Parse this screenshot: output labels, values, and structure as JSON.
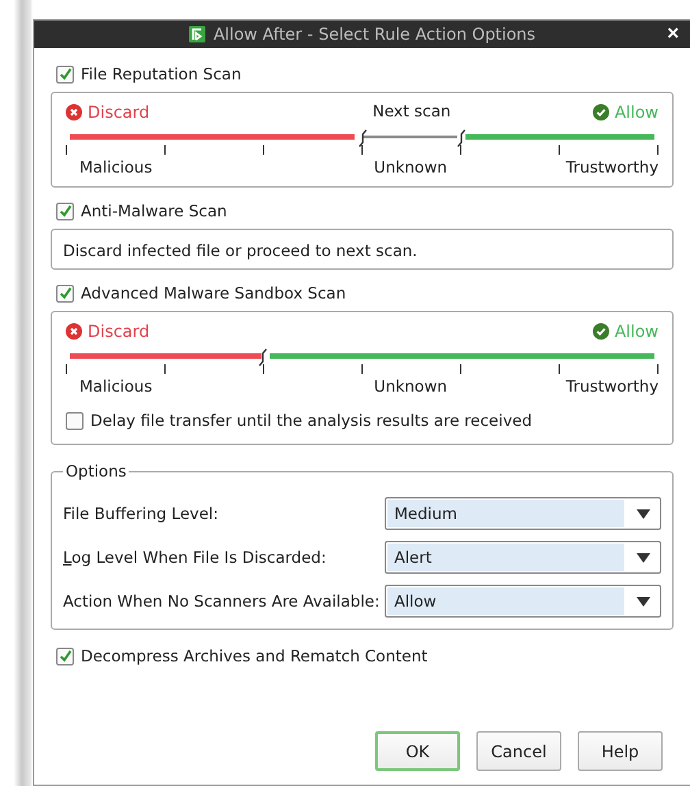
{
  "window": {
    "title": "Allow After - Select Rule Action Options",
    "close": "×"
  },
  "scans": [
    {
      "kind": "slider",
      "label": "File Reputation Scan",
      "checked": true,
      "discard": "Discard",
      "allow": "Allow",
      "middle": "Next scan",
      "thumbs": [
        {
          "level": 0.5
        },
        {
          "level": 0.667
        }
      ],
      "ticks": [
        "Malicious",
        "Unknown",
        "Trustworthy"
      ]
    },
    {
      "kind": "text",
      "label": "Anti-Malware Scan",
      "checked": true,
      "text": "Discard infected file or proceed to next scan."
    },
    {
      "kind": "slider",
      "label": "Advanced Malware Sandbox Scan",
      "checked": true,
      "discard": "Discard",
      "allow": "Allow",
      "thumbs": [
        {
          "level": 0.333
        }
      ],
      "ticks": [
        "Malicious",
        "Unknown",
        "Trustworthy"
      ],
      "option": {
        "label": "Delay file transfer until the analysis results are received",
        "checked": false
      }
    }
  ],
  "options": {
    "title": "Options",
    "rows": [
      {
        "label": "File Buffering Level:",
        "value": "Medium",
        "mnemonic": false
      },
      {
        "label": "Log Level When File Is Discarded:",
        "value": "Alert",
        "mnemonic": true
      },
      {
        "label": "Action When No Scanners Are Available:",
        "value": "Allow",
        "mnemonic": false
      }
    ]
  },
  "decompress": {
    "label": "Decompress Archives and Rematch Content",
    "checked": true
  },
  "buttons": [
    {
      "label": "OK",
      "selected": true
    },
    {
      "label": "Cancel",
      "selected": false
    },
    {
      "label": "Help",
      "selected": false
    }
  ]
}
